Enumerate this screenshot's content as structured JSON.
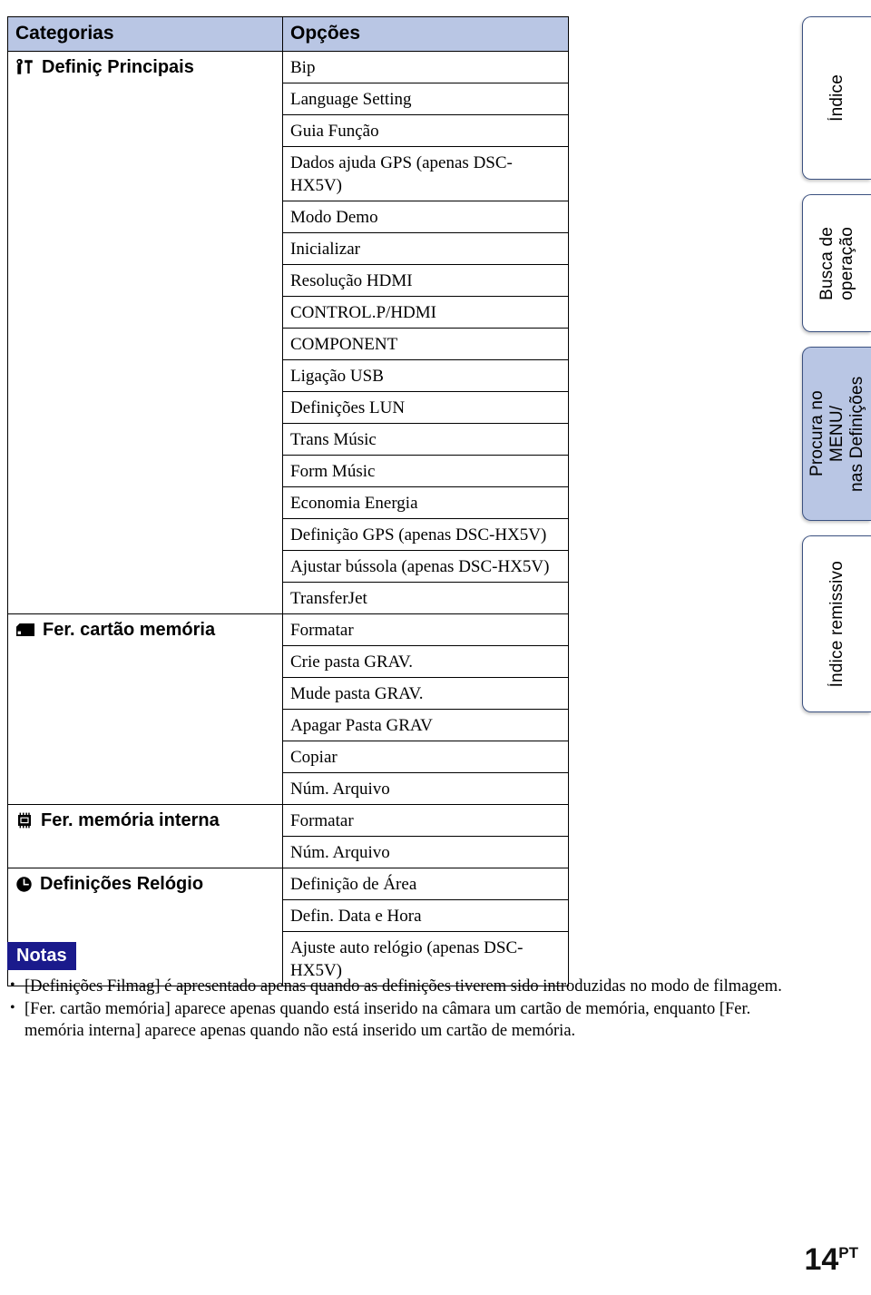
{
  "table": {
    "headers": {
      "categories": "Categorias",
      "options": "Opções"
    },
    "groups": [
      {
        "category": "Definiç Principais",
        "icon": "toolbox-icon",
        "options": [
          "Bip",
          "Language Setting",
          "Guia Função",
          "Dados ajuda GPS (apenas DSC-HX5V)",
          "Modo Demo",
          "Inicializar",
          "Resolução HDMI",
          "CONTROL.P/HDMI",
          "COMPONENT",
          "Ligação USB",
          "Definições LUN",
          "Trans Músic",
          "Form Músic",
          "Economia Energia",
          "Definição GPS (apenas DSC-HX5V)",
          "Ajustar bússola (apenas DSC-HX5V)",
          "TransferJet"
        ]
      },
      {
        "category": "Fer. cartão memória",
        "icon": "memory-card-icon",
        "options": [
          "Formatar",
          "Crie pasta GRAV.",
          "Mude pasta GRAV.",
          "Apagar Pasta GRAV",
          "Copiar",
          "Núm. Arquivo"
        ]
      },
      {
        "category": "Fer. memória interna",
        "icon": "memory-chip-icon",
        "options": [
          "Formatar",
          "Núm. Arquivo"
        ]
      },
      {
        "category": "Definições Relógio",
        "icon": "clock-icon",
        "options": [
          "Definição de Área",
          "Defin. Data e Hora",
          "Ajuste auto relógio (apenas DSC-HX5V)"
        ]
      }
    ]
  },
  "notas": {
    "badge": "Notas",
    "items": [
      "[Definições Filmag] é apresentado apenas quando as definições tiverem sido introduzidas no modo de filmagem.",
      "[Fer. cartão memória] aparece apenas quando está inserido na câmara um cartão de memória, enquanto [Fer. memória interna] aparece apenas quando não está inserido um cartão de memória."
    ]
  },
  "side_tabs": [
    {
      "label": "Índice",
      "active": false
    },
    {
      "label": "Busca de\noperação",
      "active": false
    },
    {
      "label": "Procura no MENU/\nnas Definições",
      "active": true
    },
    {
      "label": "Índice remissivo",
      "active": false
    }
  ],
  "footer": {
    "page_number": "14",
    "page_suffix": "PT"
  },
  "colors": {
    "header_fill": "#b9c6e4",
    "tab_active_fill": "#b9c6e4",
    "tab_border": "#3b5180",
    "notas_badge": "#1a1a8c"
  }
}
